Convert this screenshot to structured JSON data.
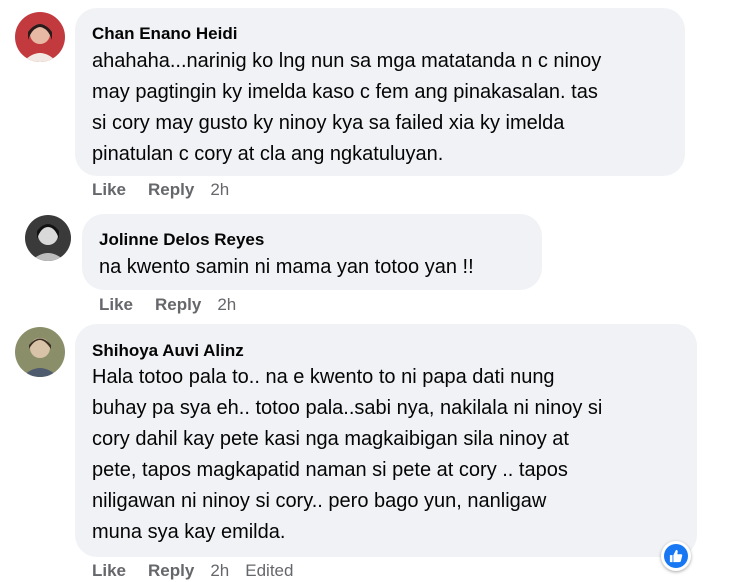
{
  "comments": [
    {
      "author": "Chan Enano Heidi",
      "lines": [
        "ahahaha...narinig ko lng nun sa mga matatanda n c ninoy",
        "may pagtingin ky imelda kaso c fem ang pinakasalan. tas",
        "si cory may gusto ky ninoy kya sa failed xia ky imelda",
        "pinatulan c cory at cla ang ngkatuluyan."
      ],
      "like_label": "Like",
      "reply_label": "Reply",
      "time": "2h"
    },
    {
      "author": "Jolinne Delos Reyes",
      "lines": [
        "na kwento samin ni mama yan totoo yan !!"
      ],
      "like_label": "Like",
      "reply_label": "Reply",
      "time": "2h"
    },
    {
      "author": "Shihoya Auvi Alinz",
      "lines": [
        "Hala totoo pala to.. na e kwento to ni papa dati nung",
        "buhay pa sya eh.. totoo pala..sabi nya, nakilala ni ninoy si",
        "cory dahil kay pete kasi nga magkaibigan sila ninoy at",
        "pete, tapos magkapatid naman si pete at cory .. tapos",
        "niligawan ni ninoy si cory.. pero bago yun, nanligaw",
        "muna sya kay emilda."
      ],
      "like_label": "Like",
      "reply_label": "Reply",
      "time": "2h",
      "edited_label": "Edited"
    }
  ],
  "reaction_icon": "thumbs-up-icon",
  "colors": {
    "bubble": "#f0f2f5",
    "meta_text": "#65676b",
    "like_blue": "#1877f2"
  }
}
